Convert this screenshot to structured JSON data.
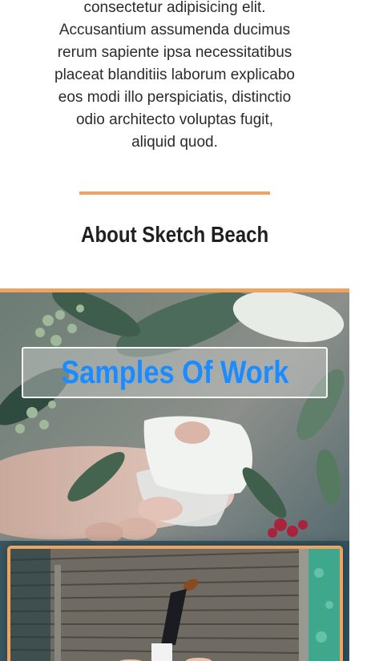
{
  "intro": {
    "text": "consectetur adipisicing elit. Accusantium assumenda ducimus rerum sapiente ipsa necessitatibus placeat blanditiis laborum explicabo eos modi illo perspiciatis, distinctio odio architecto voluptas fugit, aliquid quod."
  },
  "about": {
    "title": "About Sketch Beach"
  },
  "gallery": {
    "samples_title": "Samples Of Work"
  },
  "colors": {
    "accent": "#F0A35E",
    "link_blue": "#1A8CFF"
  }
}
